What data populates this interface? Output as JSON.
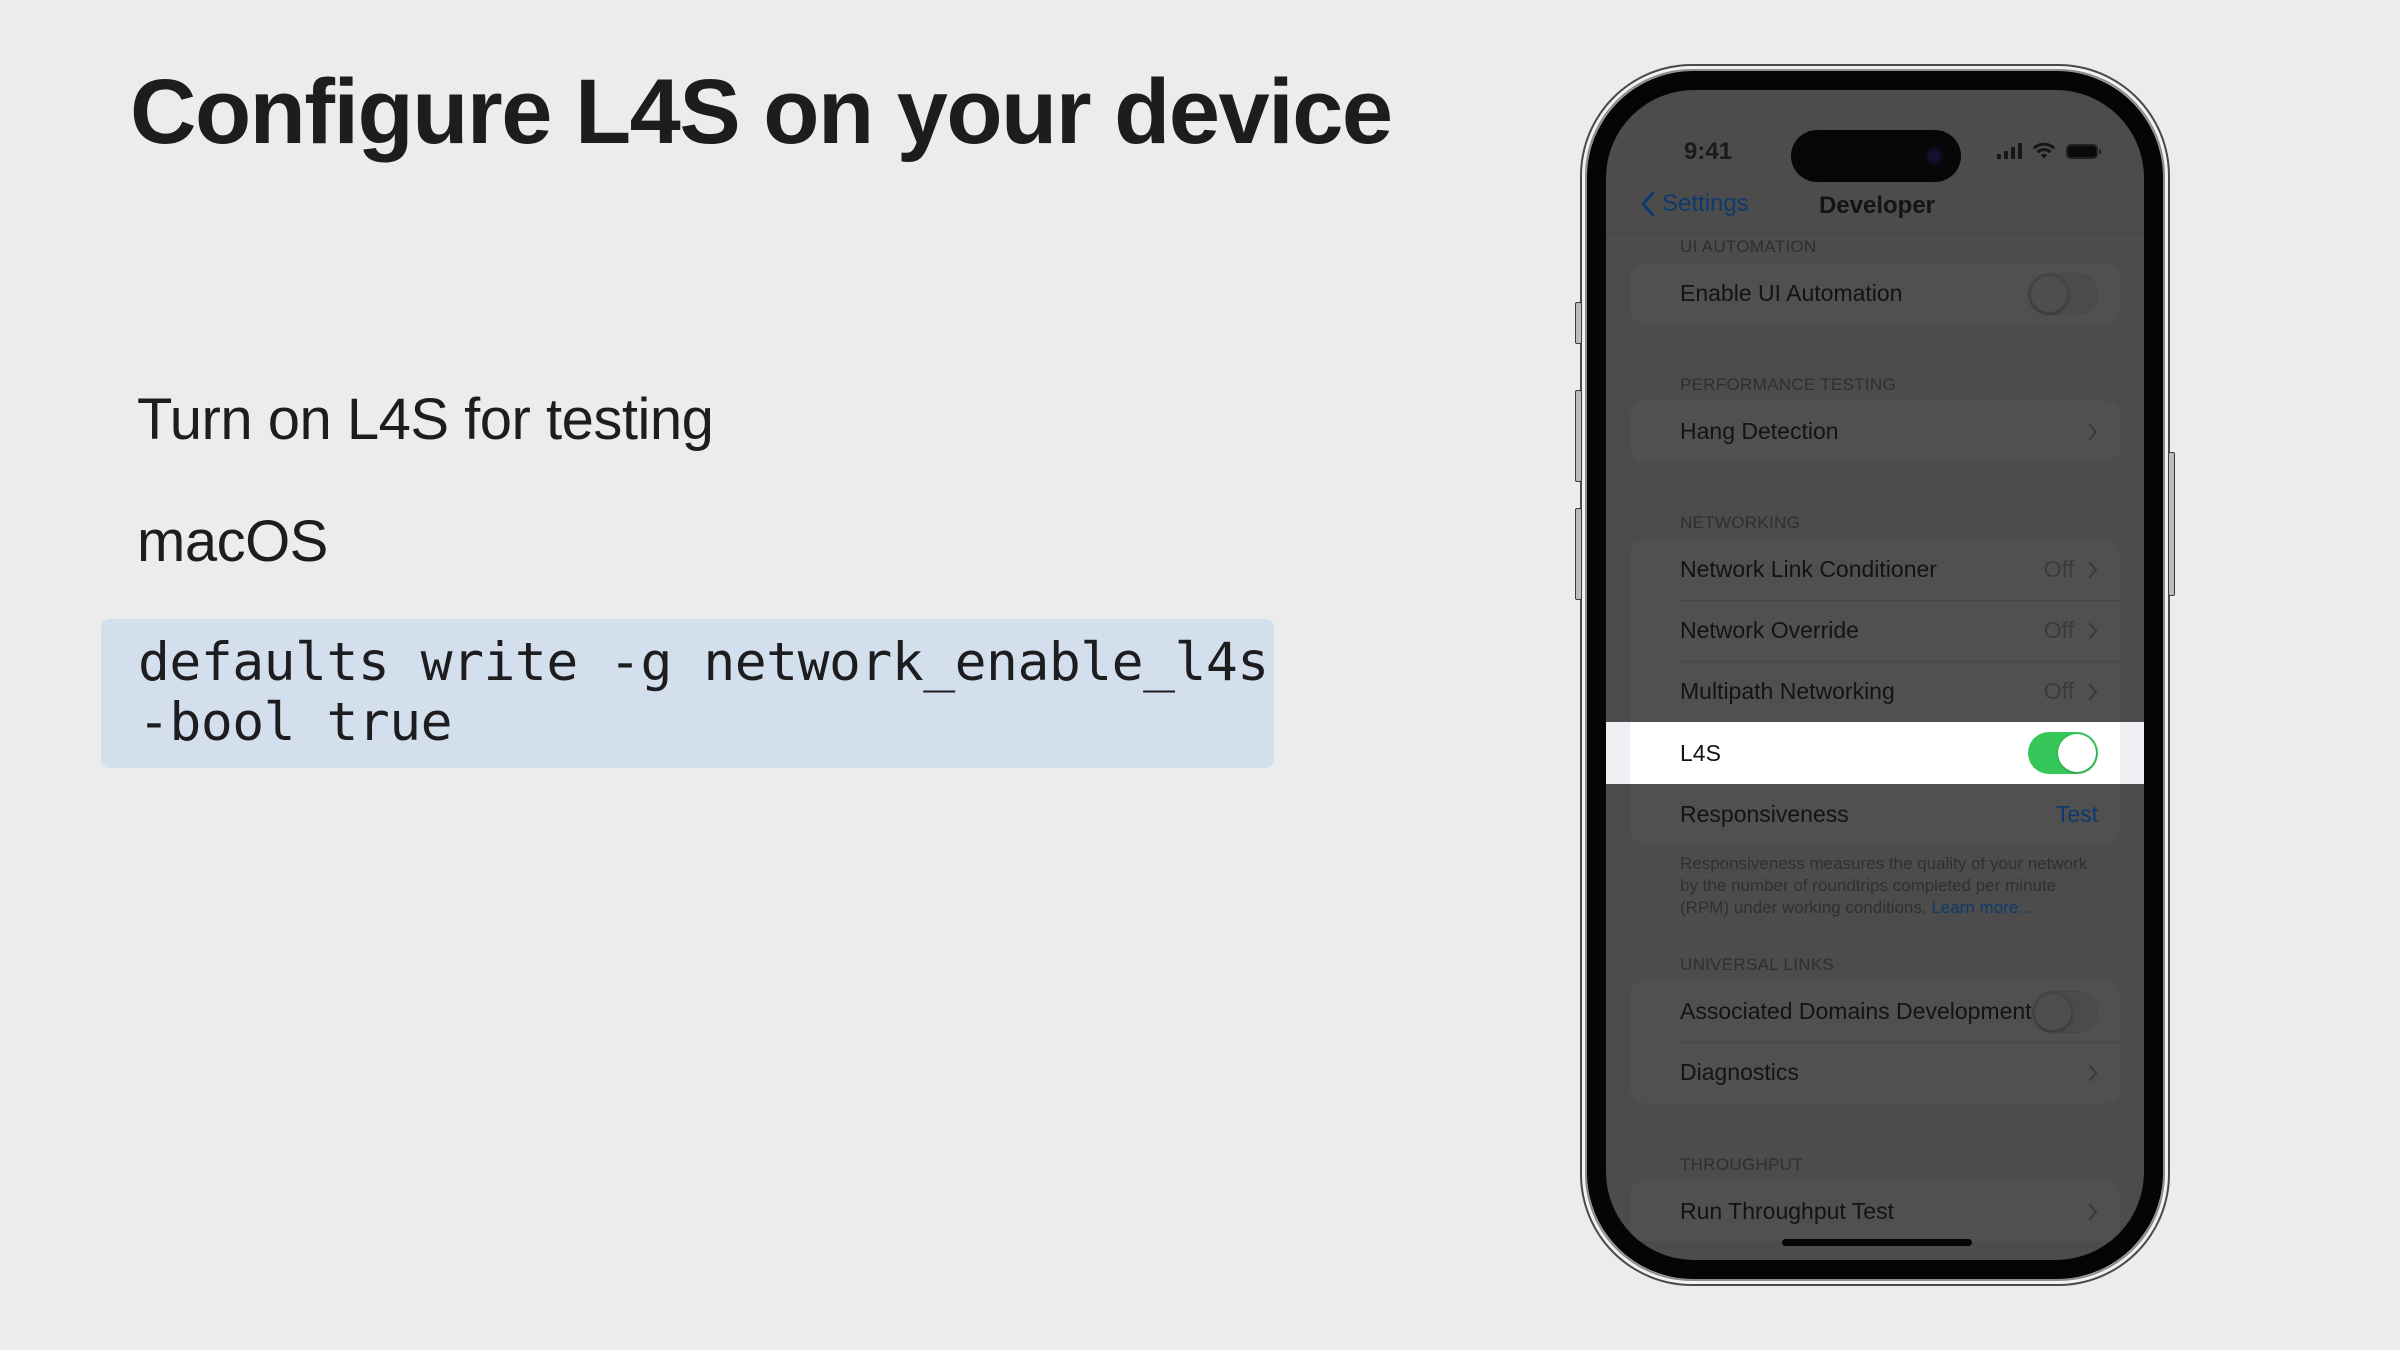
{
  "slide": {
    "title": "Configure L4S on your device",
    "bullets": [
      "Turn on L4S for testing",
      "macOS"
    ],
    "code": {
      "lines": [
        "defaults write -g network_enable_l4s",
        "-bool true"
      ],
      "background": "#d4dfee"
    }
  },
  "phone": {
    "status_bar": {
      "time": "9:41",
      "icons": [
        "cellular-signal-icon",
        "wifi-icon",
        "battery-icon"
      ]
    },
    "nav": {
      "back_label": "Settings",
      "back_icon": "chevron-left-icon",
      "title": "Developer"
    },
    "sections": [
      {
        "header": "UI Automation",
        "rows": [
          {
            "label": "Enable UI Automation",
            "control": "toggle",
            "on": false
          }
        ]
      },
      {
        "header": "Performance Testing",
        "rows": [
          {
            "label": "Hang Detection",
            "control": "chevron"
          }
        ]
      },
      {
        "header": "Networking",
        "rows": [
          {
            "label": "Network Link Conditioner",
            "value": "Off",
            "control": "chevron"
          },
          {
            "label": "Network Override",
            "value": "Off",
            "control": "chevron"
          },
          {
            "label": "Multipath Networking",
            "value": "Off",
            "control": "chevron"
          },
          {
            "label": "L4S",
            "control": "toggle",
            "on": true,
            "highlighted": true
          },
          {
            "label": "Responsiveness",
            "action": "Test"
          }
        ],
        "footer": "Responsiveness measures the quality of your network by the number of roundtrips completed per minute (RPM) under working conditions.",
        "footer_link": "Learn more..."
      },
      {
        "header": "Universal Links",
        "rows": [
          {
            "label": "Associated Domains Development",
            "control": "toggle",
            "on": false
          },
          {
            "label": "Diagnostics",
            "control": "chevron"
          }
        ]
      },
      {
        "header": "Throughput",
        "rows": [
          {
            "label": "Run Throughput Test",
            "control": "chevron"
          }
        ]
      }
    ],
    "colors": {
      "toggle_on": "#35c759",
      "link": "#0e3a6e",
      "highlight": "#ffffff"
    }
  }
}
